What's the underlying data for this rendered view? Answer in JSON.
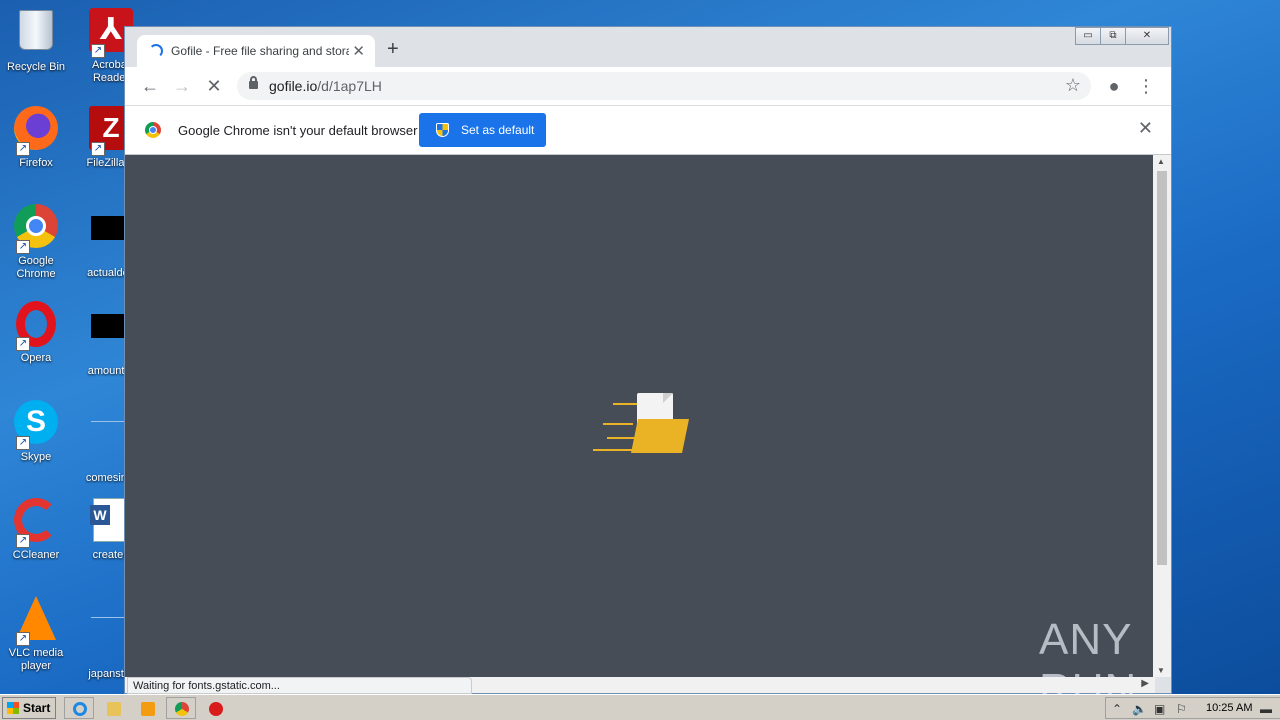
{
  "desktop": {
    "icons": {
      "recycle_bin": "Recycle Bin",
      "acrobat": "Acrobat Reader",
      "firefox": "Firefox",
      "filezilla": "FileZilla C",
      "chrome": "Google Chrome",
      "actualdoe": "actualdoe",
      "opera": "Opera",
      "amountar": "amountar",
      "skype": "Skype",
      "comesinte": "comesinte",
      "ccleaner": "CCleaner",
      "createn": "createn",
      "vlc": "VLC media player",
      "japanstor": "japanstor"
    }
  },
  "browser": {
    "tab": {
      "title": "Gofile - Free file sharing and storage"
    },
    "window_controls": {
      "minimize": "▭",
      "restore": "⧉",
      "close": "✕"
    },
    "address": {
      "domain": "gofile.io",
      "path": "/d/1ap7LH"
    },
    "infobar": {
      "message": "Google Chrome isn't your default browser",
      "button": "Set as default"
    },
    "status": "Waiting for fonts.gstatic.com...",
    "page_background": "#474d57",
    "loader_color": "#e9b325"
  },
  "watermark": "ANY RUN",
  "taskbar": {
    "start": "Start",
    "clock": "10:25 AM"
  }
}
